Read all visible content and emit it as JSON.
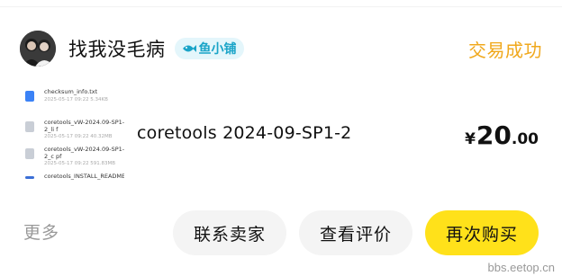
{
  "order": {
    "shop_name": "找我没毛病",
    "shop_badge": "鱼小铺",
    "status": "交易成功",
    "product_title": "coretools 2024-09-SP1-2",
    "price": {
      "currency": "¥",
      "integer": "20",
      "decimal": ".00"
    }
  },
  "thumbnail_files": [
    {
      "name": "checksum_info.txt",
      "meta": "2025-05-17  09:22  5.34KB",
      "icon": "txt-file-icon",
      "color": "#3b82f6"
    },
    {
      "name": "coretools_vW-2024.09-SP1-2_li f",
      "meta": "2025-05-17  09:22  40.32MB",
      "icon": "generic-file-icon",
      "color": "#c9ced6"
    },
    {
      "name": "coretools_vW-2024.09-SP1-2_c pf",
      "meta": "2025-05-17  09:22  591.83MB",
      "icon": "generic-file-icon",
      "color": "#c9ced6"
    },
    {
      "name": "coretools_INSTALL_README",
      "meta": "",
      "icon": "generic-file-icon",
      "color": "#3b6fd6"
    }
  ],
  "actions": {
    "more": "更多",
    "contact_seller": "联系卖家",
    "view_review": "查看评价",
    "buy_again": "再次购买"
  },
  "watermark": "bbs.eetop.cn",
  "colors": {
    "status": "#f0a81c",
    "badge_bg": "#e4f6fb",
    "badge_text": "#1aa4c8",
    "primary_button": "#ffe11a",
    "secondary_button": "#f4f4f4"
  }
}
